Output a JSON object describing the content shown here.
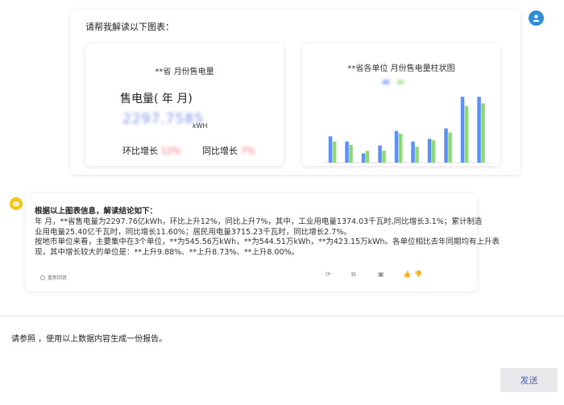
{
  "user_message": {
    "prompt": "请帮我解读以下图表：",
    "kpi_card": {
      "title": "**省  月份售电量",
      "label": "售电量(     年  月)",
      "value": "2297.7585",
      "unit": "kWH",
      "mom_label": "环比增长",
      "mom_value": "12%",
      "yoy_label": "同比增长",
      "yoy_value": "7%"
    },
    "chart_card": {
      "title": "**省各单位  月份售电量柱状图",
      "chart_data": {
        "type": "bar",
        "title": "**省各单位  月份售电量柱状图",
        "categories": [
          "",
          "",
          "",
          "",
          "",
          "",
          "",
          "",
          "",
          ""
        ],
        "series": [
          {
            "name": "",
            "color": "#5b8ff9",
            "values": [
              40,
              32,
              14,
              26,
              48,
              32,
              36,
              52,
              100,
              100
            ]
          },
          {
            "name": "",
            "color": "#8bd977",
            "values": [
              32,
              27,
              18,
              18,
              44,
              24,
              34,
              46,
              86,
              90
            ]
          }
        ],
        "ylim": [
          0,
          110
        ],
        "grid": false,
        "legend": "top-center"
      }
    }
  },
  "assistant_message": {
    "title": "根据以上图表信息，解读结论如下：",
    "lines": [
      "          年    月，**省售电量为2297.76亿kWh，环比上升12%，同比上升7%，其中，工业用电量1374.03千瓦时,同比增长3.1%；累计制造",
      "业用电量25.40亿千瓦时，同比增长11.60%；居民用电量3715.23千瓦时，同比增长2.7%。",
      "按地市单位来看，主要集中在3个单位，**为545.56万kWh，**为544.51万kWh，**为423.15万kWh。各单位相比去年同期均有上升表",
      "现，其中增长较大的单位是：**上升9.88%、**上升8.73%、**上升8.00%。"
    ],
    "footer_label": "重新回答"
  },
  "input": {
    "text": "请参照                                  ，使用以上数据内容生成一份报告。"
  },
  "send_button_label": "发送"
}
